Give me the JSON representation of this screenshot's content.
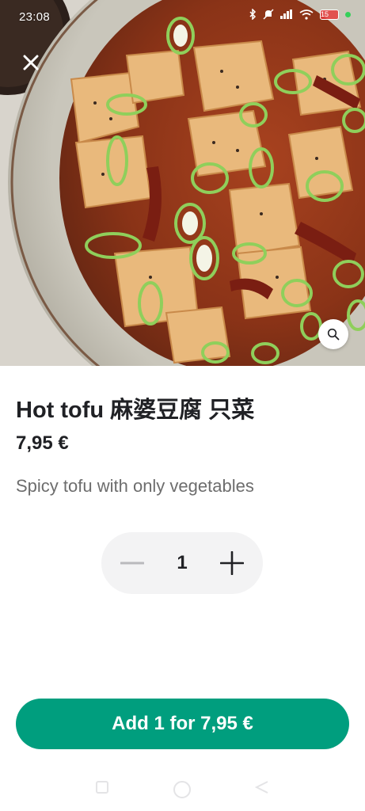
{
  "status_bar": {
    "time": "23:08",
    "icons": [
      "bluetooth-icon",
      "mute-icon",
      "signal-icon",
      "wifi-icon",
      "battery-icon"
    ],
    "battery_level": "15"
  },
  "hero": {
    "image_subject": "spicy tofu dish with scallions and chili in a ceramic plate",
    "close_icon": "close-icon",
    "zoom_icon": "search-icon"
  },
  "item": {
    "title": "Hot tofu 麻婆豆腐 只菜",
    "price": "7,95 €",
    "description": "Spicy tofu with only vegetables"
  },
  "stepper": {
    "quantity": "1",
    "minus_icon": "minus-icon",
    "plus_icon": "plus-icon"
  },
  "cta": {
    "label": "Add 1 for 7,95 €",
    "color": "#009e7e"
  },
  "nav_bar": {
    "icons": [
      "recents-icon",
      "home-icon",
      "back-icon"
    ]
  }
}
